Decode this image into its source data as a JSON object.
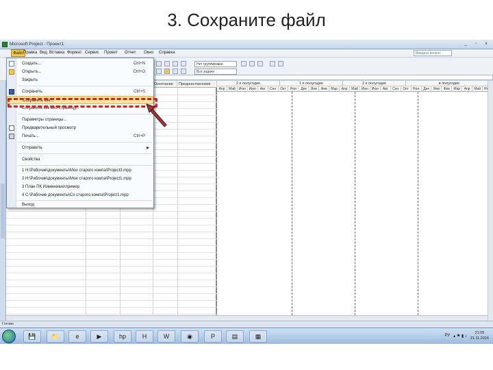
{
  "slide": {
    "title": "3. Сохраните файл"
  },
  "window": {
    "title": "Microsoft Project - Проект1",
    "controls": [
      "_",
      "▫",
      "x"
    ],
    "help_placeholder": "Введите вопрос"
  },
  "menubar": {
    "items": [
      "Файл",
      "Правка",
      "Вид",
      "Вставка",
      "Формат",
      "Сервис",
      "Проект",
      "Отчет",
      "Окно",
      "Справка"
    ]
  },
  "toolbar": {
    "combo_group": "Нет группировки",
    "combo_filter": "Все задачи"
  },
  "file_menu": {
    "items": [
      {
        "label": "Создать...",
        "shortcut": "Ctrl+N",
        "icon": "new-file-icon"
      },
      {
        "label": "Открыть...",
        "shortcut": "Ctrl+O",
        "icon": "open-folder-icon"
      },
      {
        "label": "Закрыть",
        "shortcut": "",
        "icon": ""
      },
      {
        "label": "Сохранить",
        "shortcut": "Ctrl+S",
        "icon": "save-icon"
      },
      {
        "label": "Сохранить как...",
        "shortcut": "",
        "icon": ""
      },
      {
        "label": "Сохранить как веб-страницу...",
        "shortcut": "",
        "icon": ""
      },
      {
        "label": "Параметры страницы...",
        "shortcut": "",
        "icon": ""
      },
      {
        "label": "Предварительный просмотр",
        "shortcut": "",
        "icon": "preview-icon"
      },
      {
        "label": "Печать...",
        "shortcut": "Ctrl+P",
        "icon": "print-icon"
      },
      {
        "label": "Отправить",
        "shortcut": "",
        "icon": "",
        "submenu": true
      },
      {
        "label": "Свойства",
        "shortcut": "",
        "icon": ""
      },
      {
        "label": "1 H:\\Рабочие\\документы\\Мои старого компа\\Project3.mpp",
        "shortcut": "",
        "icon": ""
      },
      {
        "label": "2 H:\\Рабочие\\документы\\Мои старого компа\\Project1.mpp",
        "shortcut": "",
        "icon": ""
      },
      {
        "label": "3 План ПК Изменение\\пример",
        "shortcut": "",
        "icon": ""
      },
      {
        "label": "4 C:\\Рабочие документы\\Со старого компа\\Project1.mpp",
        "shortcut": "",
        "icon": ""
      },
      {
        "label": "Выход",
        "shortcut": "",
        "icon": ""
      }
    ]
  },
  "table": {
    "headers": [
      "Окончание",
      "Предшественники"
    ]
  },
  "gantt": {
    "periods": [
      "2 е полугодие",
      "1 е полугодие",
      "2 е полугодие",
      "в полугодие"
    ],
    "months": [
      "Апр",
      "Май",
      "Июн",
      "Июл",
      "Авг",
      "Сен",
      "Окт",
      "Ноя",
      "Дек",
      "Янв",
      "Фев",
      "Мар",
      "Апр",
      "Май",
      "Июн",
      "Июл",
      "Авг",
      "Сен",
      "Окт",
      "Ноя",
      "Дек",
      "Янв",
      "Фев",
      "Мар",
      "Апр",
      "Май",
      "Июн"
    ]
  },
  "statusbar": {
    "text": "Готово"
  },
  "taskbar": {
    "lang": "РУ",
    "time": "21:05",
    "date": "21.11.2016"
  },
  "colors": {
    "highlight": "#d71f1f",
    "selected_item": "#fbe3a0",
    "active_menu": "#f6c64a"
  }
}
